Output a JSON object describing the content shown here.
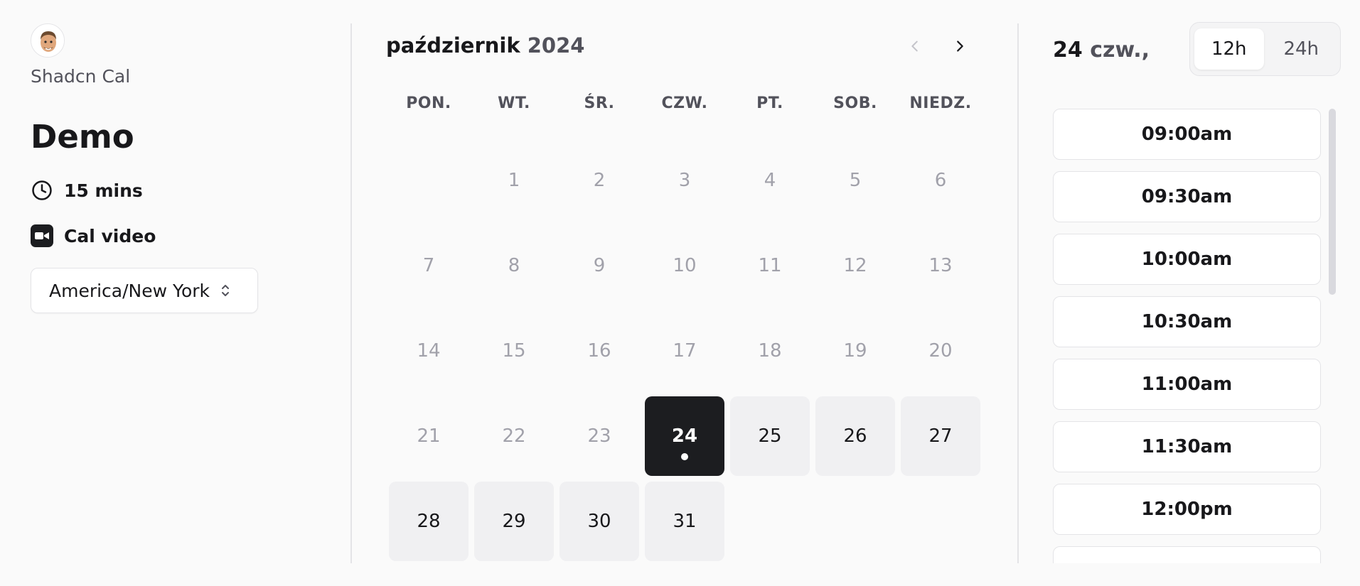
{
  "sidebar": {
    "avatar_icon": "memoji-avatar",
    "org_name": "Shadcn Cal",
    "event_title": "Demo",
    "duration": {
      "icon": "clock-icon",
      "label": "15 mins"
    },
    "location": {
      "icon": "video-camera-icon",
      "label": "Cal video"
    },
    "timezone": {
      "value": "America/New York",
      "icon": "chevrons-up-down-icon"
    }
  },
  "calendar": {
    "month": "październik",
    "year": "2024",
    "prev_icon": "chevron-left-icon",
    "next_icon": "chevron-right-icon",
    "weekdays": [
      "PON.",
      "WT.",
      "ŚR.",
      "CZW.",
      "PT.",
      "SOB.",
      "NIEDZ."
    ],
    "days": [
      {
        "d": "1",
        "s": "disabled"
      },
      {
        "d": "2",
        "s": "disabled"
      },
      {
        "d": "3",
        "s": "disabled"
      },
      {
        "d": "4",
        "s": "disabled"
      },
      {
        "d": "5",
        "s": "disabled"
      },
      {
        "d": "6",
        "s": "disabled"
      },
      {
        "d": "7",
        "s": "disabled"
      },
      {
        "d": "8",
        "s": "disabled"
      },
      {
        "d": "9",
        "s": "disabled"
      },
      {
        "d": "10",
        "s": "disabled"
      },
      {
        "d": "11",
        "s": "disabled"
      },
      {
        "d": "12",
        "s": "disabled"
      },
      {
        "d": "13",
        "s": "disabled"
      },
      {
        "d": "14",
        "s": "disabled"
      },
      {
        "d": "15",
        "s": "disabled"
      },
      {
        "d": "16",
        "s": "disabled"
      },
      {
        "d": "17",
        "s": "disabled"
      },
      {
        "d": "18",
        "s": "disabled"
      },
      {
        "d": "19",
        "s": "disabled"
      },
      {
        "d": "20",
        "s": "disabled"
      },
      {
        "d": "21",
        "s": "disabled"
      },
      {
        "d": "22",
        "s": "disabled"
      },
      {
        "d": "23",
        "s": "disabled"
      },
      {
        "d": "24",
        "s": "selected"
      },
      {
        "d": "25",
        "s": "available"
      },
      {
        "d": "26",
        "s": "available"
      },
      {
        "d": "27",
        "s": "available"
      },
      {
        "d": "28",
        "s": "available"
      },
      {
        "d": "29",
        "s": "available"
      },
      {
        "d": "30",
        "s": "available"
      },
      {
        "d": "31",
        "s": "available"
      }
    ]
  },
  "slots_panel": {
    "selected_day": "24",
    "selected_dow": "czw.,",
    "format_options": [
      "12h",
      "24h"
    ],
    "active_format": "12h",
    "times": [
      "09:00am",
      "09:30am",
      "10:00am",
      "10:30am",
      "11:00am",
      "11:30am",
      "12:00pm"
    ]
  },
  "colors": {
    "selected_day_bg": "#1c1d20",
    "available_day_bg": "#f0f0f2",
    "disabled_text": "#a1a1aa",
    "border": "#e4e4e7"
  }
}
